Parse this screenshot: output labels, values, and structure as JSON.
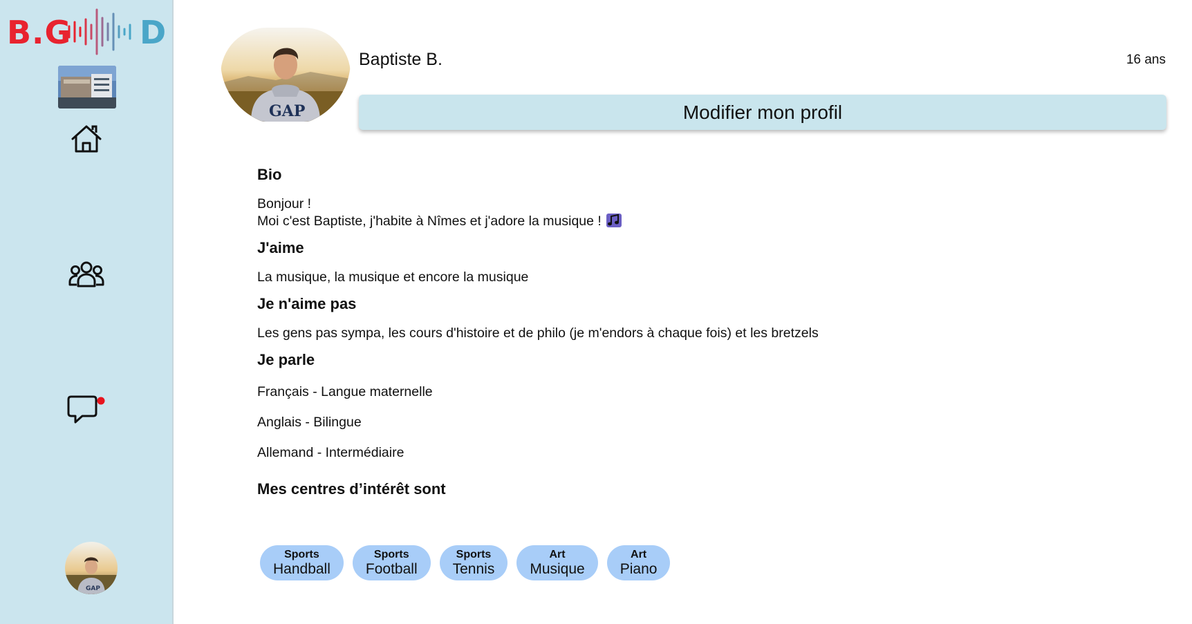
{
  "logo": {
    "left_text": "B.G",
    "right_text": "D",
    "colors": {
      "red": "#e8232f",
      "blue": "#4aa6c8"
    }
  },
  "sidebar": {
    "items": [
      {
        "icon": "home-icon"
      },
      {
        "icon": "group-icon"
      },
      {
        "icon": "chat-icon",
        "notification": true,
        "notification_color": "#e8141e"
      },
      {
        "icon": "avatar"
      }
    ]
  },
  "profile": {
    "name": "Baptiste B.",
    "age": "16 ans",
    "edit_label": "Modifier mon profil"
  },
  "sections": {
    "bio_title": "Bio",
    "bio_line1": "Bonjour !",
    "bio_line2": "Moi c'est Baptiste, j'habite à Nîmes et j'adore la musique !",
    "likes_title": "J'aime",
    "likes_text": "La musique, la musique et encore la musique",
    "dislikes_title": "Je n'aime pas",
    "dislikes_text": "Les gens pas sympa, les cours d'histoire et de philo (je m'endors à chaque fois) et les bretzels",
    "languages_title": "Je parle",
    "languages": [
      "Français - Langue maternelle",
      "Anglais - Bilingue",
      "Allemand - Intermédiaire"
    ],
    "interests_title": "Mes centres d’intérêt sont"
  },
  "interests": [
    {
      "category": "Sports",
      "value": "Handball"
    },
    {
      "category": "Sports",
      "value": "Football"
    },
    {
      "category": "Sports",
      "value": "Tennis"
    },
    {
      "category": "Art",
      "value": "Musique"
    },
    {
      "category": "Art",
      "value": "Piano"
    }
  ],
  "colors": {
    "sidebar_bg": "#cbe5ee",
    "button_bg": "#c9e5ed",
    "chip_bg": "#a8cdf8"
  }
}
